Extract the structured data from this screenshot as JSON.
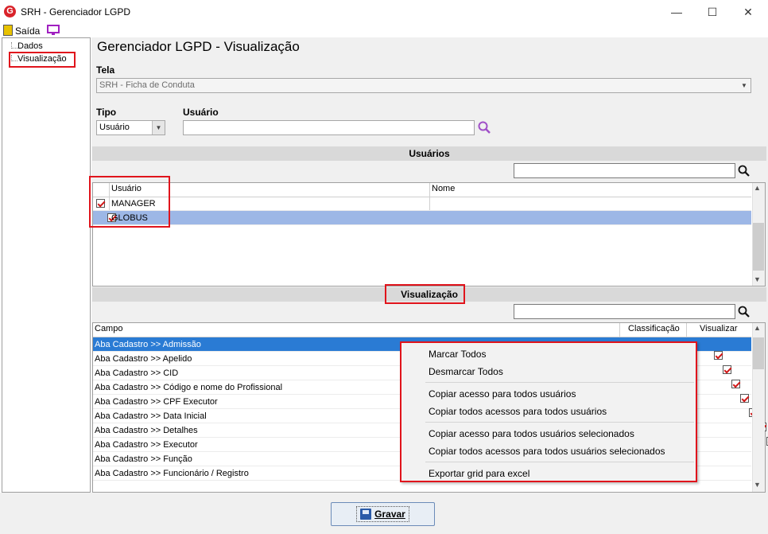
{
  "window": {
    "title": "SRH - Gerenciador LGPD",
    "logo_letter": "G",
    "minimize": "—",
    "maximize": "☐",
    "close": "✕"
  },
  "menu": {
    "sair": "Saída"
  },
  "tree": {
    "items": [
      "Dados",
      "Visualização"
    ]
  },
  "page": {
    "title": "Gerenciador LGPD - Visualização"
  },
  "tela": {
    "label": "Tela",
    "value": "SRH - Ficha de Conduta"
  },
  "tipo": {
    "label": "Tipo",
    "value": "Usuário"
  },
  "usuario": {
    "label": "Usuário",
    "value": ""
  },
  "usuarios_section": {
    "title": "Usuários",
    "columns": [
      "Usuário",
      "Nome"
    ],
    "rows": [
      {
        "usuario": "MANAGER",
        "nome": "",
        "checked": true,
        "selected": false
      },
      {
        "usuario": "GLOBUS",
        "nome": "",
        "checked": true,
        "selected": true
      }
    ]
  },
  "visualizacao_section": {
    "title": "Visualização",
    "columns": [
      "Campo",
      "Classificação",
      "Visualizar"
    ],
    "rows": [
      {
        "campo": "Aba Cadastro >> Admissão",
        "visualizar": true
      },
      {
        "campo": "Aba Cadastro >> Apelido",
        "visualizar": true
      },
      {
        "campo": "Aba Cadastro >> CID",
        "visualizar": true
      },
      {
        "campo": "Aba Cadastro >> Código e nome do Profissional",
        "visualizar": true
      },
      {
        "campo": "Aba Cadastro >> CPF Executor",
        "visualizar": true
      },
      {
        "campo": "Aba Cadastro >> Data Inicial",
        "visualizar": true
      },
      {
        "campo": "Aba Cadastro >> Detalhes",
        "visualizar": true
      },
      {
        "campo": "Aba Cadastro >> Executor",
        "visualizar": true
      },
      {
        "campo": "Aba Cadastro >> Função",
        "visualizar": true
      },
      {
        "campo": "Aba Cadastro >> Funcionário / Registro",
        "visualizar": true
      }
    ]
  },
  "context_menu": {
    "items": [
      "Marcar Todos",
      "Desmarcar Todos",
      "Copiar acesso para todos usuários",
      "Copiar todos acessos para todos usuários",
      "Copiar acesso para todos usuários selecionados",
      "Copiar todos acessos para todos usuários selecionados",
      "Exportar grid para excel"
    ]
  },
  "gravar": {
    "label": "Gravar",
    "accel": "G"
  },
  "colors": {
    "highlight": "#2a7bd4",
    "selected_row": "#9db7e6",
    "annotation_red": "#e0141c"
  }
}
